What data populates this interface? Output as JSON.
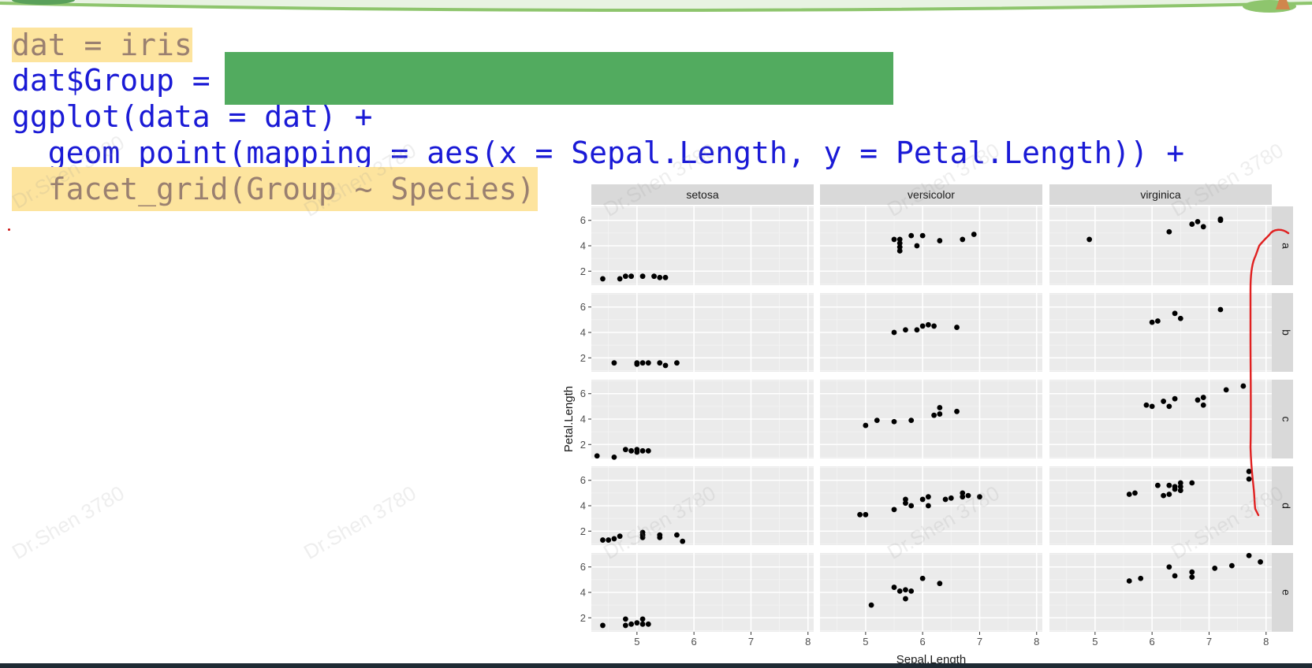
{
  "code": {
    "lines": [
      "dat = iris",
      "dat$Group = ",
      "ggplot(data = dat) +",
      "  geom_point(mapping = aes(x = Sepal.Length, y = Petal.Length)) +",
      "  facet_grid(Group ~ Species)"
    ]
  },
  "watermark": "Dr.Shen 3780",
  "colors": {
    "code_text": "#1a1ad6",
    "highlight": "#fde49e",
    "redaction": "#52ab5f",
    "panel_bg": "#ebebeb",
    "strip_bg": "#d9d9d9",
    "annotation": "#e02020"
  },
  "chart_data": {
    "type": "scatter",
    "xlabel": "Sepal.Length",
    "ylabel": "Petal.Length",
    "col_facets": [
      "setosa",
      "versicolor",
      "virginica"
    ],
    "row_facets": [
      "a",
      "b",
      "c",
      "d",
      "e"
    ],
    "x_ticks": [
      "5",
      "6",
      "7",
      "8"
    ],
    "y_ticks": [
      "2",
      "4",
      "6"
    ],
    "xlim": [
      4.2,
      8.1
    ],
    "ylim": [
      0.9,
      7.1
    ],
    "grid": true,
    "points": {
      "a": {
        "setosa": [
          [
            4.4,
            1.4
          ],
          [
            4.7,
            1.4
          ],
          [
            4.8,
            1.6
          ],
          [
            4.9,
            1.6
          ],
          [
            5.1,
            1.6
          ],
          [
            5.3,
            1.6
          ],
          [
            5.4,
            1.5
          ],
          [
            5.5,
            1.5
          ]
        ],
        "versicolor": [
          [
            5.5,
            4.5
          ],
          [
            5.6,
            4.5
          ],
          [
            5.6,
            4.2
          ],
          [
            5.6,
            3.9
          ],
          [
            5.6,
            3.6
          ],
          [
            5.8,
            4.8
          ],
          [
            5.9,
            4.0
          ],
          [
            6.0,
            4.8
          ],
          [
            6.3,
            4.4
          ],
          [
            6.7,
            4.5
          ],
          [
            6.9,
            4.9
          ]
        ],
        "virginica": [
          [
            4.9,
            4.5
          ],
          [
            6.3,
            5.1
          ],
          [
            6.7,
            5.7
          ],
          [
            6.8,
            5.9
          ],
          [
            6.9,
            5.5
          ],
          [
            7.2,
            6.1
          ],
          [
            7.2,
            6.0
          ]
        ]
      },
      "b": {
        "setosa": [
          [
            4.6,
            1.6
          ],
          [
            5.0,
            1.5
          ],
          [
            5.0,
            1.6
          ],
          [
            5.1,
            1.6
          ],
          [
            5.2,
            1.6
          ],
          [
            5.4,
            1.6
          ],
          [
            5.5,
            1.4
          ],
          [
            5.7,
            1.6
          ]
        ],
        "versicolor": [
          [
            5.5,
            4.0
          ],
          [
            5.7,
            4.2
          ],
          [
            5.9,
            4.2
          ],
          [
            6.0,
            4.5
          ],
          [
            6.1,
            4.6
          ],
          [
            6.2,
            4.5
          ],
          [
            6.6,
            4.4
          ]
        ],
        "virginica": [
          [
            6.0,
            4.8
          ],
          [
            6.1,
            4.9
          ],
          [
            6.4,
            5.5
          ],
          [
            6.5,
            5.1
          ],
          [
            7.2,
            5.8
          ]
        ]
      },
      "c": {
        "setosa": [
          [
            4.3,
            1.1
          ],
          [
            4.6,
            1.0
          ],
          [
            4.8,
            1.6
          ],
          [
            4.9,
            1.5
          ],
          [
            5.0,
            1.4
          ],
          [
            5.0,
            1.6
          ],
          [
            5.1,
            1.5
          ],
          [
            5.2,
            1.5
          ]
        ],
        "versicolor": [
          [
            5.0,
            3.5
          ],
          [
            5.2,
            3.9
          ],
          [
            5.5,
            3.8
          ],
          [
            5.8,
            3.9
          ],
          [
            6.2,
            4.3
          ],
          [
            6.3,
            4.4
          ],
          [
            6.3,
            4.9
          ],
          [
            6.6,
            4.6
          ]
        ],
        "virginica": [
          [
            5.9,
            5.1
          ],
          [
            6.0,
            5.0
          ],
          [
            6.2,
            5.4
          ],
          [
            6.3,
            5.0
          ],
          [
            6.4,
            5.6
          ],
          [
            6.8,
            5.5
          ],
          [
            6.9,
            5.7
          ],
          [
            6.9,
            5.1
          ],
          [
            7.3,
            6.3
          ],
          [
            7.6,
            6.6
          ]
        ]
      },
      "d": {
        "setosa": [
          [
            4.4,
            1.3
          ],
          [
            4.5,
            1.3
          ],
          [
            4.6,
            1.4
          ],
          [
            4.7,
            1.6
          ],
          [
            5.1,
            1.5
          ],
          [
            5.1,
            1.7
          ],
          [
            5.1,
            1.9
          ],
          [
            5.4,
            1.5
          ],
          [
            5.4,
            1.7
          ],
          [
            5.7,
            1.7
          ],
          [
            5.8,
            1.2
          ]
        ],
        "versicolor": [
          [
            4.9,
            3.3
          ],
          [
            5.0,
            3.3
          ],
          [
            5.5,
            3.7
          ],
          [
            5.7,
            4.2
          ],
          [
            5.7,
            4.5
          ],
          [
            5.8,
            4.0
          ],
          [
            6.0,
            4.5
          ],
          [
            6.1,
            4.0
          ],
          [
            6.1,
            4.7
          ],
          [
            6.4,
            4.5
          ],
          [
            6.5,
            4.6
          ],
          [
            6.7,
            4.7
          ],
          [
            6.7,
            5.0
          ],
          [
            6.8,
            4.8
          ],
          [
            7.0,
            4.7
          ]
        ],
        "virginica": [
          [
            5.6,
            4.9
          ],
          [
            5.7,
            5.0
          ],
          [
            6.1,
            5.6
          ],
          [
            6.2,
            4.8
          ],
          [
            6.3,
            4.9
          ],
          [
            6.3,
            5.6
          ],
          [
            6.4,
            5.3
          ],
          [
            6.4,
            5.5
          ],
          [
            6.5,
            5.2
          ],
          [
            6.5,
            5.5
          ],
          [
            6.5,
            5.8
          ],
          [
            6.7,
            5.8
          ],
          [
            7.7,
            6.1
          ],
          [
            7.7,
            6.7
          ]
        ]
      },
      "e": {
        "setosa": [
          [
            4.4,
            1.4
          ],
          [
            4.8,
            1.4
          ],
          [
            4.8,
            1.9
          ],
          [
            4.9,
            1.5
          ],
          [
            5.0,
            1.6
          ],
          [
            5.1,
            1.5
          ],
          [
            5.1,
            1.9
          ],
          [
            5.2,
            1.5
          ]
        ],
        "versicolor": [
          [
            5.1,
            3.0
          ],
          [
            5.5,
            4.4
          ],
          [
            5.6,
            4.1
          ],
          [
            5.7,
            3.5
          ],
          [
            5.7,
            4.2
          ],
          [
            5.8,
            4.1
          ],
          [
            6.0,
            5.1
          ],
          [
            6.3,
            4.7
          ]
        ],
        "virginica": [
          [
            5.6,
            4.9
          ],
          [
            5.8,
            5.1
          ],
          [
            6.3,
            6.0
          ],
          [
            6.4,
            5.3
          ],
          [
            6.7,
            5.2
          ],
          [
            6.7,
            5.6
          ],
          [
            7.1,
            5.9
          ],
          [
            7.4,
            6.1
          ],
          [
            7.7,
            6.9
          ],
          [
            7.9,
            6.4
          ]
        ]
      }
    }
  }
}
